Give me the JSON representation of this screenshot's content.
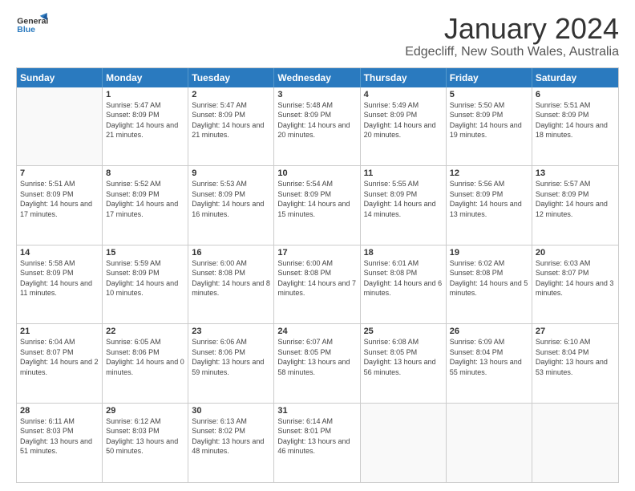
{
  "header": {
    "logo_line1": "General",
    "logo_line2": "Blue",
    "title": "January 2024",
    "subtitle": "Edgecliff, New South Wales, Australia"
  },
  "days_of_week": [
    "Sunday",
    "Monday",
    "Tuesday",
    "Wednesday",
    "Thursday",
    "Friday",
    "Saturday"
  ],
  "weeks": [
    [
      {
        "day": "",
        "empty": true
      },
      {
        "day": "1",
        "sunrise": "5:47 AM",
        "sunset": "8:09 PM",
        "daylight": "14 hours and 21 minutes."
      },
      {
        "day": "2",
        "sunrise": "5:47 AM",
        "sunset": "8:09 PM",
        "daylight": "14 hours and 21 minutes."
      },
      {
        "day": "3",
        "sunrise": "5:48 AM",
        "sunset": "8:09 PM",
        "daylight": "14 hours and 20 minutes."
      },
      {
        "day": "4",
        "sunrise": "5:49 AM",
        "sunset": "8:09 PM",
        "daylight": "14 hours and 20 minutes."
      },
      {
        "day": "5",
        "sunrise": "5:50 AM",
        "sunset": "8:09 PM",
        "daylight": "14 hours and 19 minutes."
      },
      {
        "day": "6",
        "sunrise": "5:51 AM",
        "sunset": "8:09 PM",
        "daylight": "14 hours and 18 minutes."
      }
    ],
    [
      {
        "day": "7",
        "sunrise": "5:51 AM",
        "sunset": "8:09 PM",
        "daylight": "14 hours and 17 minutes."
      },
      {
        "day": "8",
        "sunrise": "5:52 AM",
        "sunset": "8:09 PM",
        "daylight": "14 hours and 17 minutes."
      },
      {
        "day": "9",
        "sunrise": "5:53 AM",
        "sunset": "8:09 PM",
        "daylight": "14 hours and 16 minutes."
      },
      {
        "day": "10",
        "sunrise": "5:54 AM",
        "sunset": "8:09 PM",
        "daylight": "14 hours and 15 minutes."
      },
      {
        "day": "11",
        "sunrise": "5:55 AM",
        "sunset": "8:09 PM",
        "daylight": "14 hours and 14 minutes."
      },
      {
        "day": "12",
        "sunrise": "5:56 AM",
        "sunset": "8:09 PM",
        "daylight": "14 hours and 13 minutes."
      },
      {
        "day": "13",
        "sunrise": "5:57 AM",
        "sunset": "8:09 PM",
        "daylight": "14 hours and 12 minutes."
      }
    ],
    [
      {
        "day": "14",
        "sunrise": "5:58 AM",
        "sunset": "8:09 PM",
        "daylight": "14 hours and 11 minutes."
      },
      {
        "day": "15",
        "sunrise": "5:59 AM",
        "sunset": "8:09 PM",
        "daylight": "14 hours and 10 minutes."
      },
      {
        "day": "16",
        "sunrise": "6:00 AM",
        "sunset": "8:08 PM",
        "daylight": "14 hours and 8 minutes."
      },
      {
        "day": "17",
        "sunrise": "6:00 AM",
        "sunset": "8:08 PM",
        "daylight": "14 hours and 7 minutes."
      },
      {
        "day": "18",
        "sunrise": "6:01 AM",
        "sunset": "8:08 PM",
        "daylight": "14 hours and 6 minutes."
      },
      {
        "day": "19",
        "sunrise": "6:02 AM",
        "sunset": "8:08 PM",
        "daylight": "14 hours and 5 minutes."
      },
      {
        "day": "20",
        "sunrise": "6:03 AM",
        "sunset": "8:07 PM",
        "daylight": "14 hours and 3 minutes."
      }
    ],
    [
      {
        "day": "21",
        "sunrise": "6:04 AM",
        "sunset": "8:07 PM",
        "daylight": "14 hours and 2 minutes."
      },
      {
        "day": "22",
        "sunrise": "6:05 AM",
        "sunset": "8:06 PM",
        "daylight": "14 hours and 0 minutes."
      },
      {
        "day": "23",
        "sunrise": "6:06 AM",
        "sunset": "8:06 PM",
        "daylight": "13 hours and 59 minutes."
      },
      {
        "day": "24",
        "sunrise": "6:07 AM",
        "sunset": "8:05 PM",
        "daylight": "13 hours and 58 minutes."
      },
      {
        "day": "25",
        "sunrise": "6:08 AM",
        "sunset": "8:05 PM",
        "daylight": "13 hours and 56 minutes."
      },
      {
        "day": "26",
        "sunrise": "6:09 AM",
        "sunset": "8:04 PM",
        "daylight": "13 hours and 55 minutes."
      },
      {
        "day": "27",
        "sunrise": "6:10 AM",
        "sunset": "8:04 PM",
        "daylight": "13 hours and 53 minutes."
      }
    ],
    [
      {
        "day": "28",
        "sunrise": "6:11 AM",
        "sunset": "8:03 PM",
        "daylight": "13 hours and 51 minutes."
      },
      {
        "day": "29",
        "sunrise": "6:12 AM",
        "sunset": "8:03 PM",
        "daylight": "13 hours and 50 minutes."
      },
      {
        "day": "30",
        "sunrise": "6:13 AM",
        "sunset": "8:02 PM",
        "daylight": "13 hours and 48 minutes."
      },
      {
        "day": "31",
        "sunrise": "6:14 AM",
        "sunset": "8:01 PM",
        "daylight": "13 hours and 46 minutes."
      },
      {
        "day": "",
        "empty": true
      },
      {
        "day": "",
        "empty": true
      },
      {
        "day": "",
        "empty": true
      }
    ]
  ]
}
